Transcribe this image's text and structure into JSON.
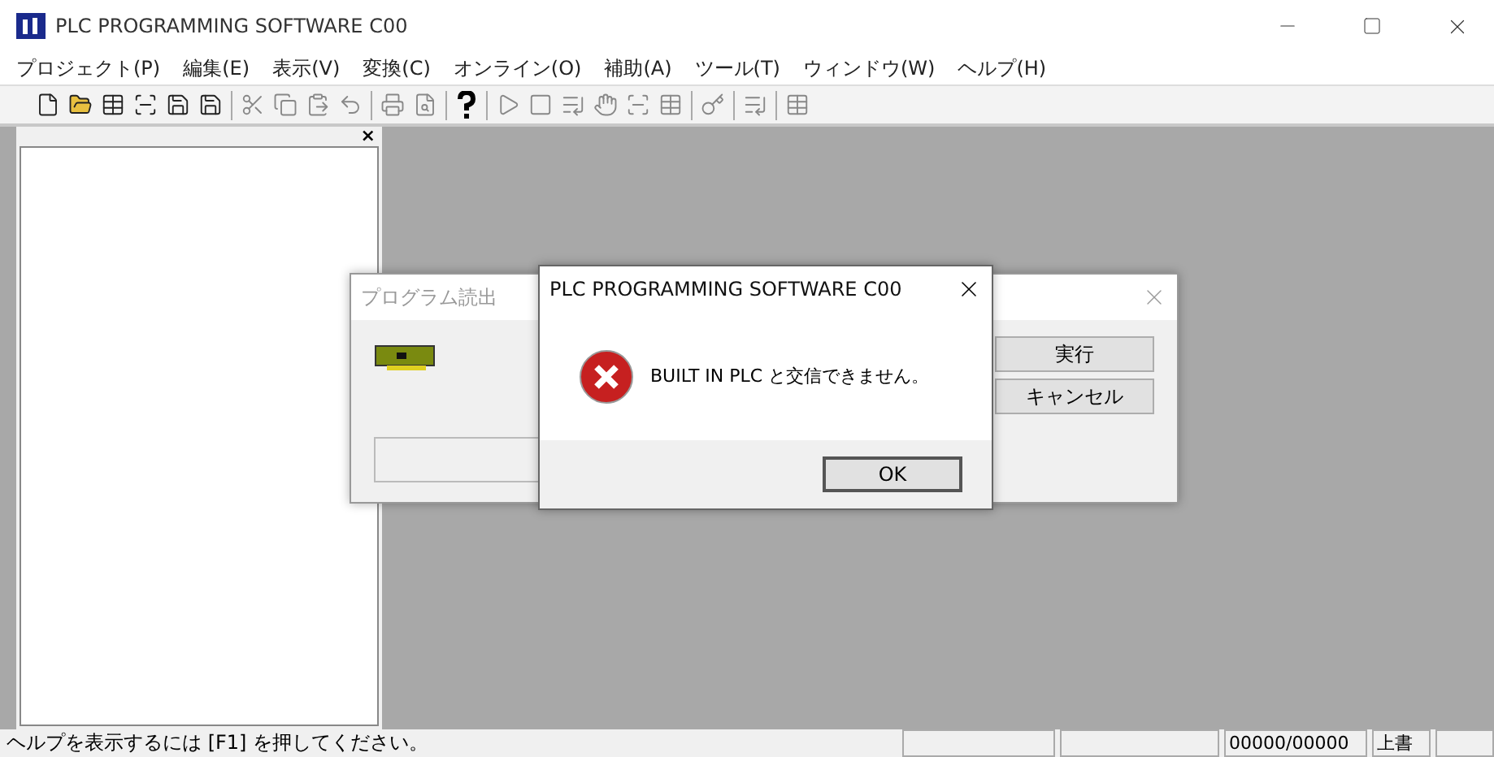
{
  "window": {
    "title": "PLC PROGRAMMING SOFTWARE C00"
  },
  "menu": [
    "プロジェクト(P)",
    "編集(E)",
    "表示(V)",
    "変換(C)",
    "オンライン(O)",
    "補助(A)",
    "ツール(T)",
    "ウィンドウ(W)",
    "ヘルプ(H)"
  ],
  "side_panel": {
    "close": "×"
  },
  "background_dialog": {
    "title": "プログラム読出",
    "buttons": [
      "実行",
      "キャンセル"
    ]
  },
  "message_box": {
    "title": "PLC PROGRAMMING SOFTWARE C00",
    "message": "BUILT IN PLC と交信できません。",
    "button": "OK"
  },
  "status_bar": {
    "help": "ヘルプを表示するには [F1] を押してください。",
    "panels": [
      "00000/00000",
      "上書"
    ]
  }
}
